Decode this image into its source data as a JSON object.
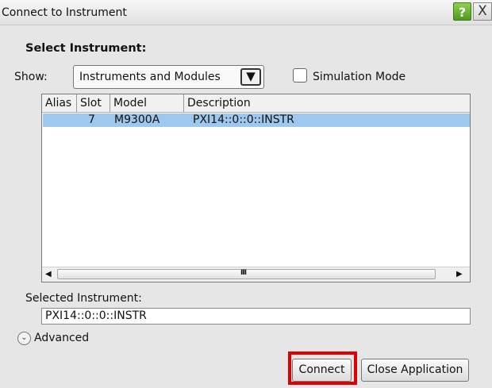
{
  "window": {
    "title": "Connect to Instrument",
    "help_label": "?",
    "close_label": "X"
  },
  "select_instrument": {
    "heading": "Select Instrument:",
    "show_label": "Show:",
    "show_value": "Instruments and Modules",
    "dropdown_glyph": "⮟",
    "simulation_label": "Simulation Mode",
    "simulation_checked": false
  },
  "table": {
    "columns": [
      "Alias",
      "Slot",
      "Model",
      "Description"
    ],
    "rows": [
      {
        "alias": "",
        "slot": "7",
        "model": "M9300A",
        "description": "PXI14::0::0::INSTR",
        "selected": true
      }
    ]
  },
  "scrollbar": {
    "left_arrow": "◀",
    "right_arrow": "▶",
    "grip": "III"
  },
  "selected": {
    "label": "Selected Instrument:",
    "value": "PXI14::0::0::INSTR"
  },
  "advanced": {
    "label": "Advanced",
    "icon_glyph": "⌄"
  },
  "buttons": {
    "connect": "Connect",
    "close_application": "Close Application"
  },
  "colors": {
    "selected_row": "#9ec8ee",
    "highlight_box": "#e00000",
    "help_green": "#4e9a1c"
  }
}
